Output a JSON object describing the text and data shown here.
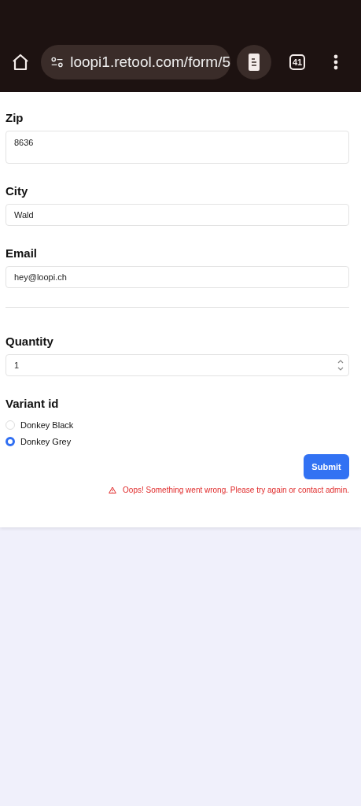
{
  "browser": {
    "url": "loopi1.retool.com/form/5",
    "tab_count": "41"
  },
  "form": {
    "items": [
      {
        "kind": "textarea",
        "label": "Zip",
        "value": "8636"
      },
      {
        "kind": "text",
        "label": "City",
        "value": "Wald"
      },
      {
        "kind": "text",
        "label": "Email",
        "value": "hey@loopi.ch"
      },
      {
        "kind": "divider"
      },
      {
        "kind": "number",
        "label": "Quantity",
        "value": "1"
      },
      {
        "kind": "radio",
        "label": "Variant id",
        "options": [
          {
            "label": "Donkey Black",
            "selected": false
          },
          {
            "label": "Donkey Grey",
            "selected": true
          }
        ]
      }
    ],
    "submit": "Submit",
    "error": "Oops! Something went wrong. Please try again or contact admin."
  }
}
